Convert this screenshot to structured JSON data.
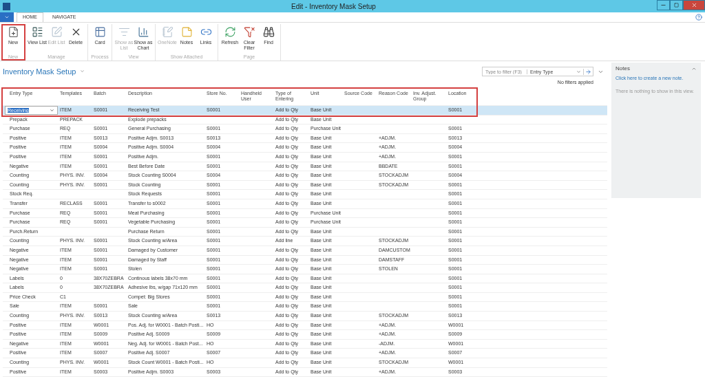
{
  "window": {
    "title": "Edit - Inventory Mask Setup"
  },
  "ribbon_tabs": [
    {
      "label": "HOME",
      "selected": true
    },
    {
      "label": "NAVIGATE",
      "selected": false
    }
  ],
  "ribbon_groups": [
    {
      "label": "New",
      "highlighted": true,
      "actions": [
        {
          "label": "New",
          "disabled": false
        }
      ]
    },
    {
      "label": "Manage",
      "highlighted": false,
      "actions": [
        {
          "label": "View List",
          "disabled": false
        },
        {
          "label": "Edit List",
          "disabled": true
        },
        {
          "label": "Delete",
          "disabled": false
        }
      ]
    },
    {
      "label": "Process",
      "highlighted": false,
      "actions": [
        {
          "label": "Card",
          "disabled": false
        }
      ]
    },
    {
      "label": "View",
      "highlighted": false,
      "actions": [
        {
          "label": "Show as List",
          "disabled": true
        },
        {
          "label": "Show as Chart",
          "disabled": false
        }
      ]
    },
    {
      "label": "Show Attached",
      "highlighted": false,
      "actions": [
        {
          "label": "OneNote",
          "disabled": true
        },
        {
          "label": "Notes",
          "disabled": false
        },
        {
          "label": "Links",
          "disabled": false
        }
      ]
    },
    {
      "label": "Page",
      "highlighted": false,
      "actions": [
        {
          "label": "Refresh",
          "disabled": false
        },
        {
          "label": "Clear Filter",
          "disabled": false
        },
        {
          "label": "Find",
          "disabled": false
        }
      ]
    }
  ],
  "page_title": "Inventory Mask Setup",
  "filter": {
    "placeholder": "Type to filter (F3)",
    "field": "Entry Type",
    "status": "No filters applied"
  },
  "table": {
    "highlight_header": true,
    "columns": [
      "Entry Type",
      "Templates",
      "Batch",
      "Description",
      "Store No.",
      "Handheld User",
      "Type of Entering",
      "Unit",
      "Source Code",
      "Reason Code",
      "Inv. Adjust. Group",
      "Location"
    ],
    "rows": [
      {
        "selected": true,
        "cells": [
          "Receiving",
          "ITEM",
          "S0001",
          "Receiving Test",
          "S0001",
          "",
          "Add to Qty",
          "Base Unit",
          "",
          "",
          "",
          "S0001"
        ]
      },
      {
        "selected": false,
        "cells": [
          "Prepack",
          "PREPACK",
          "",
          "Explode prepacks",
          "",
          "",
          "Add to Qty",
          "Base Unit",
          "",
          "",
          "",
          ""
        ]
      },
      {
        "selected": false,
        "cells": [
          "Purchase",
          "REQ",
          "S0001",
          "General Purchasing",
          "S0001",
          "",
          "Add to Qty",
          "Purchase Unit",
          "",
          "",
          "",
          "S0001"
        ]
      },
      {
        "selected": false,
        "cells": [
          "Positive",
          "ITEM",
          "S0013",
          "Positive Adjm. S0013",
          "S0013",
          "",
          "Add to Qty",
          "Base Unit",
          "",
          "+ADJM.",
          "",
          "S0013"
        ]
      },
      {
        "selected": false,
        "cells": [
          "Positive",
          "ITEM",
          "S0004",
          "Positive Adjm. S0004",
          "S0004",
          "",
          "Add to Qty",
          "Base Unit",
          "",
          "+ADJM.",
          "",
          "S0004"
        ]
      },
      {
        "selected": false,
        "cells": [
          "Positive",
          "ITEM",
          "S0001",
          "Positive Adjm.",
          "S0001",
          "",
          "Add to Qty",
          "Base Unit",
          "",
          "+ADJM.",
          "",
          "S0001"
        ]
      },
      {
        "selected": false,
        "cells": [
          "Negative",
          "ITEM",
          "S0001",
          "Best Before Date",
          "S0001",
          "",
          "Add to Qty",
          "Base Unit",
          "",
          "BBDATE",
          "",
          "S0001"
        ]
      },
      {
        "selected": false,
        "cells": [
          "Counting",
          "PHYS. INV.",
          "S0004",
          "Stock Counting S0004",
          "S0004",
          "",
          "Add to Qty",
          "Base Unit",
          "",
          "STOCKADJM",
          "",
          "S0004"
        ]
      },
      {
        "selected": false,
        "cells": [
          "Counting",
          "PHYS. INV.",
          "S0001",
          "Stock Counting",
          "S0001",
          "",
          "Add to Qty",
          "Base Unit",
          "",
          "STOCKADJM",
          "",
          "S0001"
        ]
      },
      {
        "selected": false,
        "cells": [
          "Stock Req.",
          "",
          "",
          "Stock Requests",
          "S0001",
          "",
          "Add to Qty",
          "Base Unit",
          "",
          "",
          "",
          "S0001"
        ]
      },
      {
        "selected": false,
        "cells": [
          "Transfer",
          "RECLASS",
          "S0001",
          "Transfer to s0002",
          "S0001",
          "",
          "Add to Qty",
          "Base Unit",
          "",
          "",
          "",
          "S0001"
        ]
      },
      {
        "selected": false,
        "cells": [
          "Purchase",
          "REQ",
          "S0001",
          "Meat Purchasing",
          "S0001",
          "",
          "Add to Qty",
          "Purchase Unit",
          "",
          "",
          "",
          "S0001"
        ]
      },
      {
        "selected": false,
        "cells": [
          "Purchase",
          "REQ",
          "S0001",
          "Vegetable Purchasing",
          "S0001",
          "",
          "Add to Qty",
          "Purchase Unit",
          "",
          "",
          "",
          "S0001"
        ]
      },
      {
        "selected": false,
        "cells": [
          "Purch.Return",
          "",
          "",
          "Purchase Return",
          "S0001",
          "",
          "Add to Qty",
          "Base Unit",
          "",
          "",
          "",
          "S0001"
        ]
      },
      {
        "selected": false,
        "cells": [
          "Counting",
          "PHYS. INV.",
          "S0001",
          "Stock Counting w/Area",
          "S0001",
          "",
          "Add line",
          "Base Unit",
          "",
          "STOCKADJM",
          "",
          "S0001"
        ]
      },
      {
        "selected": false,
        "cells": [
          "Negative",
          "ITEM",
          "S0001",
          "Damaged by Customer",
          "S0001",
          "",
          "Add to Qty",
          "Base Unit",
          "",
          "DAMCUSTOM",
          "",
          "S0001"
        ]
      },
      {
        "selected": false,
        "cells": [
          "Negative",
          "ITEM",
          "S0001",
          "Damaged by Staff",
          "S0001",
          "",
          "Add to Qty",
          "Base Unit",
          "",
          "DAMSTAFF",
          "",
          "S0001"
        ]
      },
      {
        "selected": false,
        "cells": [
          "Negative",
          "ITEM",
          "S0001",
          "Stolen",
          "S0001",
          "",
          "Add to Qty",
          "Base Unit",
          "",
          "STOLEN",
          "",
          "S0001"
        ]
      },
      {
        "selected": false,
        "cells": [
          "Labels",
          "0",
          "38X70ZEBRA",
          "Continous labels 38x70 mm",
          "S0001",
          "",
          "Add to Qty",
          "Base Unit",
          "",
          "",
          "",
          "S0001"
        ]
      },
      {
        "selected": false,
        "cells": [
          "Labels",
          "0",
          "38X70ZEBRA",
          "Adhesive lbs, w/gap 71x120 mm",
          "S0001",
          "",
          "Add to Qty",
          "Base Unit",
          "",
          "",
          "",
          "S0001"
        ]
      },
      {
        "selected": false,
        "cells": [
          "Price Check",
          "C1",
          "",
          "Compet: Big Stores",
          "S0001",
          "",
          "Add to Qty",
          "Base Unit",
          "",
          "",
          "",
          "S0001"
        ]
      },
      {
        "selected": false,
        "cells": [
          "Sale",
          "ITEM",
          "S0001",
          "Sale",
          "S0001",
          "",
          "Add to Qty",
          "Base Unit",
          "",
          "",
          "",
          "S0001"
        ]
      },
      {
        "selected": false,
        "cells": [
          "Counting",
          "PHYS. INV.",
          "S0013",
          "Stock Counting w/Area",
          "S0013",
          "",
          "Add to Qty",
          "Base Unit",
          "",
          "STOCKADJM",
          "",
          "S0013"
        ]
      },
      {
        "selected": false,
        "cells": [
          "Positive",
          "ITEM",
          "W0001",
          "Pos. Adj. for W0001 - Batch Posti...",
          "HO",
          "",
          "Add to Qty",
          "Base Unit",
          "",
          "+ADJM.",
          "",
          "W0001"
        ]
      },
      {
        "selected": false,
        "cells": [
          "Positive",
          "ITEM",
          "S0009",
          "Positive Adj. S0009",
          "S0009",
          "",
          "Add to Qty",
          "Base Unit",
          "",
          "+ADJM.",
          "",
          "S0009"
        ]
      },
      {
        "selected": false,
        "cells": [
          "Negative",
          "ITEM",
          "W0001",
          "Neg. Adj. for W0001 - Batch Post...",
          "HO",
          "",
          "Add to Qty",
          "Base Unit",
          "",
          "-ADJM.",
          "",
          "W0001"
        ]
      },
      {
        "selected": false,
        "cells": [
          "Positive",
          "ITEM",
          "S0007",
          "Positive Adj. S0007",
          "S0007",
          "",
          "Add to Qty",
          "Base Unit",
          "",
          "+ADJM.",
          "",
          "S0007"
        ]
      },
      {
        "selected": false,
        "cells": [
          "Counting",
          "PHYS. INV.",
          "W0001",
          "Stock Count W0001 - Batch Posti...",
          "HO",
          "",
          "Add to Qty",
          "Base Unit",
          "",
          "STOCKADJM",
          "",
          "W0001"
        ]
      },
      {
        "selected": false,
        "cells": [
          "Positive",
          "ITEM",
          "S0003",
          "Positive Adjm. S0003",
          "S0003",
          "",
          "Add to Qty",
          "Base Unit",
          "",
          "+ADJM.",
          "",
          "S0003"
        ]
      }
    ]
  },
  "notes": {
    "title": "Notes",
    "link": "Click here to create a new note.",
    "empty": "There is nothing to show in this view."
  }
}
